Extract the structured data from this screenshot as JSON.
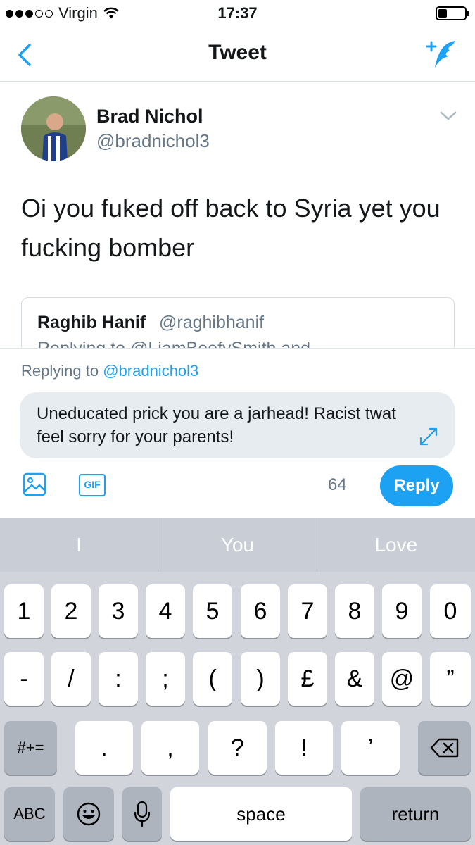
{
  "status_bar": {
    "carrier": "Virgin",
    "time": "17:37"
  },
  "nav": {
    "title": "Tweet"
  },
  "tweet": {
    "author_name": "Brad Nichol",
    "author_handle": "@bradnichol3",
    "text": "Oi you fuked off back to Syria yet you fucking bomber"
  },
  "quote": {
    "name": "Raghib Hanif",
    "handle": "@raghibhanif",
    "subtitle": "Replying to @LiamBeefySmith and"
  },
  "composer": {
    "replying_label": "Replying to",
    "replying_mention": "@bradnichol3",
    "reply_text": "Uneducated prick you are a jarhead! Racist twat feel sorry for your parents!",
    "gif_label": "GIF",
    "char_count": "64",
    "reply_button": "Reply"
  },
  "keyboard": {
    "suggestions": [
      "I",
      "You",
      "Love"
    ],
    "row1": [
      "1",
      "2",
      "3",
      "4",
      "5",
      "6",
      "7",
      "8",
      "9",
      "0"
    ],
    "row2": [
      "-",
      "/",
      ":",
      ";",
      "(",
      ")",
      "£",
      "&",
      "@",
      "”"
    ],
    "row3": [
      ".",
      ",",
      "?",
      "!",
      "’"
    ],
    "symbols_key": "#+=",
    "abc_key": "ABC",
    "space_key": "space",
    "return_key": "return"
  },
  "colors": {
    "accent": "#1da1f2",
    "muted": "#657786",
    "keyboard_bg": "#d1d5db"
  }
}
